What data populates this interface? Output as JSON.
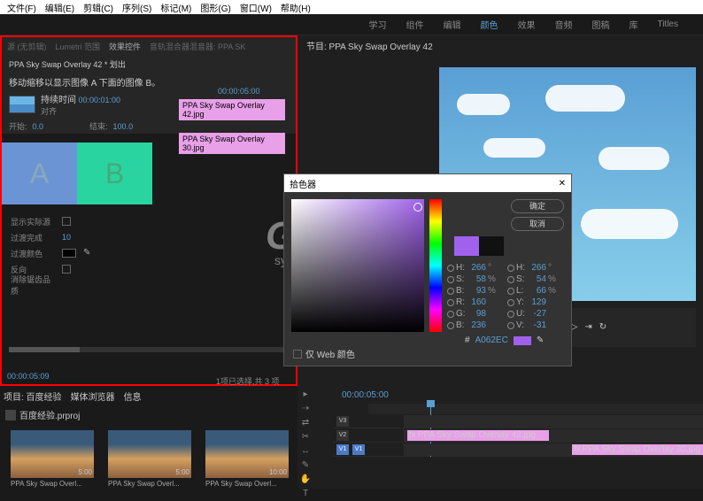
{
  "menu": {
    "file": "文件(F)",
    "edit": "编辑(E)",
    "clip": "剪辑(C)",
    "sequence": "序列(S)",
    "marker": "标记(M)",
    "graphics": "图形(G)",
    "window": "窗口(W)",
    "help": "帮助(H)"
  },
  "workspace": {
    "learn": "学习",
    "assembly": "组件",
    "editing": "编辑",
    "color": "颜色",
    "effects": "效果",
    "audio": "音频",
    "graphics": "图稿",
    "library": "库",
    "titles": "Titles"
  },
  "left_tabs": {
    "source": "源 (无剪辑)",
    "lumetri": "Lumetri 范围",
    "effect_controls": "效果控件",
    "audio_mixer": "音轨混合器混音器: PPA SK"
  },
  "effect": {
    "header": "PPA Sky Swap Overlay 42 * 划出",
    "hint": "移动缩移以显示图像 A 下面的图像 B。",
    "duration_label": "持续时间",
    "duration": "00:00:01:00",
    "align_label": "对齐",
    "start_label": "开始:",
    "start_val": "0.0",
    "end_label": "结束:",
    "end_val": "100.0",
    "clip_tc": "00:00:05:00",
    "clip1": "PPA Sky Swap Overlay 42.jpg",
    "clip2": "PPA Sky Swap Overlay 30.jpg",
    "a": "A",
    "b": "B",
    "bottom_tc": "00:00:05:09"
  },
  "props": {
    "show_actual": "显示实际源",
    "completion": "过渡完成",
    "completion_val": "10",
    "edge_color": "过渡颜色",
    "reverse": "反向",
    "anti_alias": "消除锯齿品质"
  },
  "preview": {
    "tab": "节目: PPA Sky Swap Overlay 42"
  },
  "picker": {
    "title": "拾色器",
    "ok": "确定",
    "cancel": "取消",
    "h": "H:",
    "s": "S:",
    "b": "B:",
    "r": "R:",
    "g": "G:",
    "bb": "B:",
    "oh": "H:",
    "os": "S:",
    "ol": "L:",
    "oy": "Y:",
    "ou": "U:",
    "ov": "V:",
    "hv": "266",
    "sv": "58",
    "bv": "93",
    "rv": "160",
    "gv": "98",
    "bbv": "236",
    "ohv": "266",
    "osv": "54",
    "olv": "66",
    "oyv": "129",
    "ouv": "-27",
    "ovv": "-31",
    "deg": "°",
    "pct": "%",
    "hex_label": "#",
    "hex": "A062EC",
    "web": "仅 Web 颜色"
  },
  "project": {
    "tabs": {
      "project": "项目: 百度经验",
      "media": "媒体浏览器",
      "info": "信息"
    },
    "name": "百度经验.prproj",
    "status": "1项已选择,共 3 项",
    "bins": [
      {
        "name": "PPA Sky Swap Overl...",
        "dur": "5:00"
      },
      {
        "name": "PPA Sky Swap Overl...",
        "dur": "5:00"
      },
      {
        "name": "PPA Sky Swap Overl...",
        "dur": "10:00"
      }
    ]
  },
  "timeline": {
    "tc": "00:00:05:00",
    "v3": "V3",
    "v2": "V2",
    "v1": "V1",
    "clip_v2": "PPA Sky Swap Overlay 42.jpg",
    "clip_v1": "PPA Sky Swap Overlay 30.jpg",
    "fx": "fx"
  },
  "watermark": {
    "main": "GXT 网",
    "sub": "system.com"
  }
}
